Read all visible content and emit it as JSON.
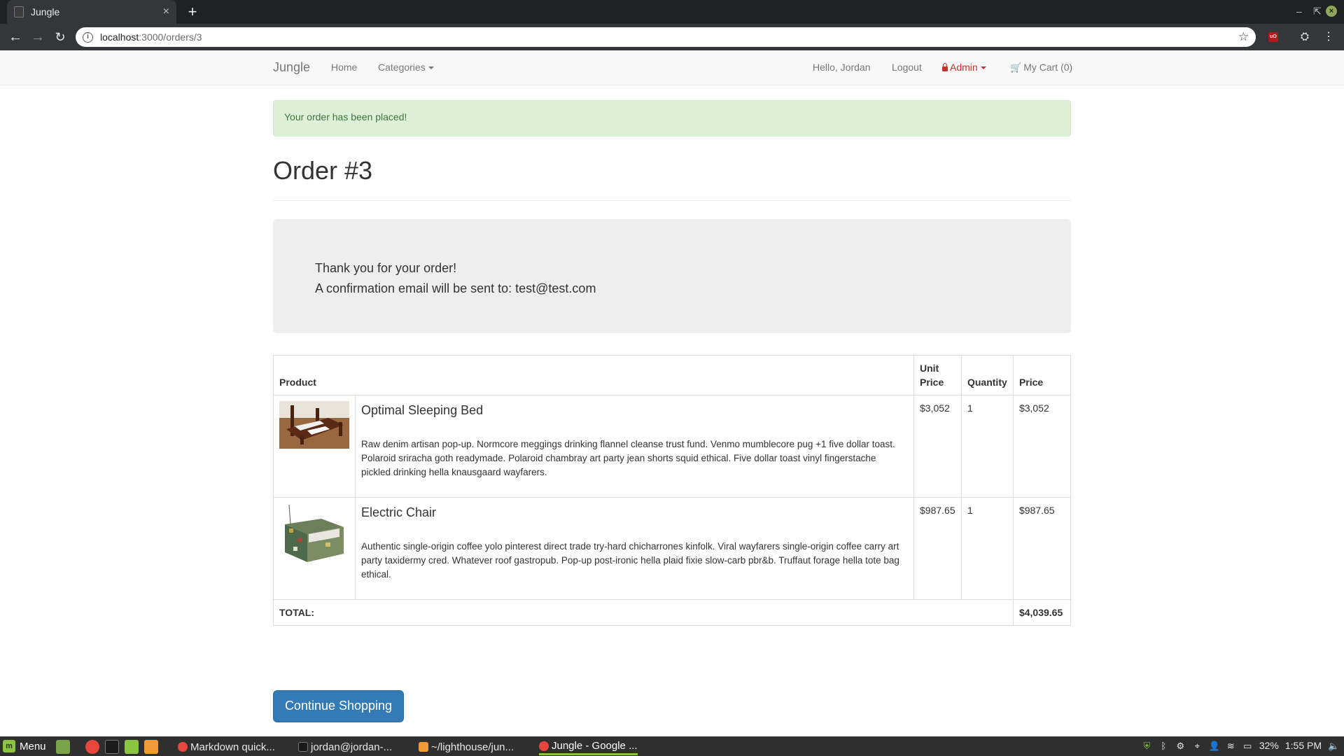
{
  "browser": {
    "tab_title": "Jungle",
    "tab_close": "×",
    "new_tab": "+",
    "url_host": "localhost",
    "url_path": ":3000/orders/3"
  },
  "navbar": {
    "brand": "Jungle",
    "home": "Home",
    "categories": "Categories",
    "greeting": "Hello, Jordan",
    "logout": "Logout",
    "admin": "Admin",
    "cart": "My Cart (0)"
  },
  "alert": {
    "message": "Your order has been placed!"
  },
  "order": {
    "title": "Order #3",
    "thanks": "Thank you for your order!",
    "confirmation": "A confirmation email will be sent to: test@test.com"
  },
  "table": {
    "headers": {
      "product": "Product",
      "unit_price_1": "Unit",
      "unit_price_2": "Price",
      "quantity": "Quantity",
      "price": "Price"
    },
    "rows": [
      {
        "name": "Optimal Sleeping Bed",
        "description": "Raw denim artisan pop-up. Normcore meggings drinking flannel cleanse trust fund. Venmo mumblecore pug +1 five dollar toast. Polaroid sriracha goth readymade. Polaroid chambray art party jean shorts squid ethical. Five dollar toast vinyl fingerstache pickled drinking hella knausgaard wayfarers.",
        "unit_price": "$3,052",
        "quantity": "1",
        "price": "$3,052"
      },
      {
        "name": "Electric Chair",
        "description": "Authentic single-origin coffee yolo pinterest direct trade try-hard chicharrones kinfolk. Viral wayfarers single-origin coffee carry art party taxidermy cred. Whatever roof gastropub. Pop-up post-ironic hella plaid fixie slow-carb pbr&b. Truffaut forage hella tote bag ethical.",
        "unit_price": "$987.65",
        "quantity": "1",
        "price": "$987.65"
      }
    ],
    "total_label": "TOTAL:",
    "total_value": "$4,039.65"
  },
  "continue_button": "Continue Shopping",
  "taskbar": {
    "menu": "Menu",
    "windows": [
      {
        "label": "Markdown quick..."
      },
      {
        "label": "jordan@jordan-..."
      },
      {
        "label": "~/lighthouse/jun..."
      },
      {
        "label": "Jungle - Google ..."
      }
    ],
    "battery": "32%",
    "clock": "1:55 PM"
  },
  "colors": {
    "brand_primary": "#337ab7",
    "alert_success_bg": "#dff0d8",
    "admin_red": "#c9302c",
    "mint_green": "#8ac53f"
  }
}
